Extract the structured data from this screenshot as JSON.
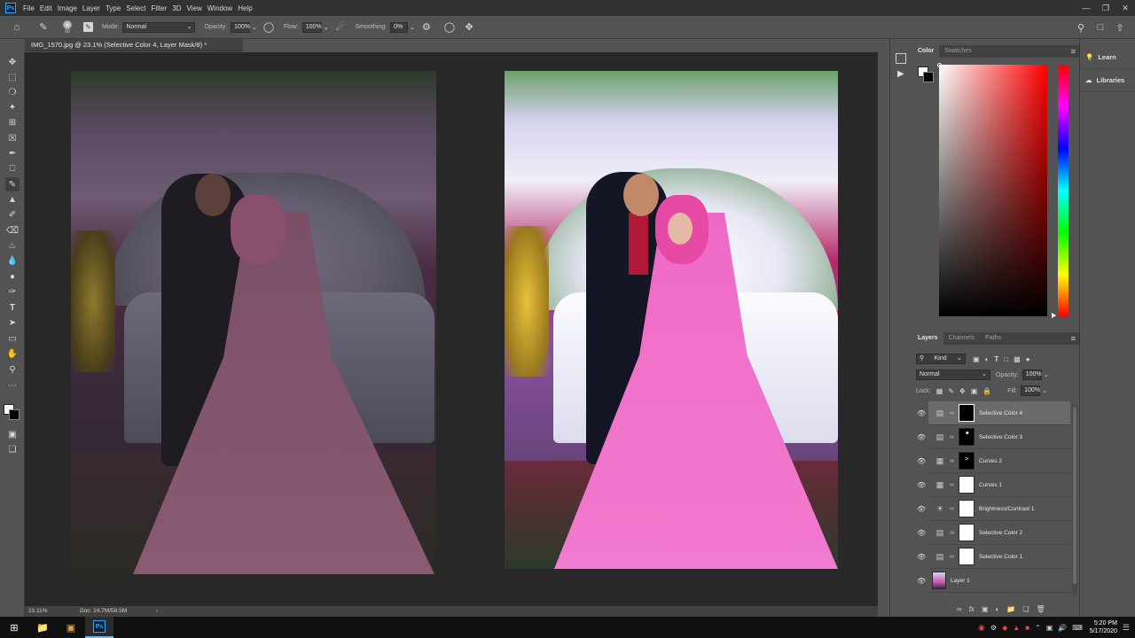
{
  "menubar": {
    "logo": "Ps",
    "items": [
      "File",
      "Edit",
      "Image",
      "Layer",
      "Type",
      "Select",
      "Filter",
      "3D",
      "View",
      "Window",
      "Help"
    ]
  },
  "options": {
    "mode_label": "Mode:",
    "mode_value": "Normal",
    "opacity_label": "Opacity:",
    "opacity_value": "100%",
    "flow_label": "Flow:",
    "flow_value": "100%",
    "smoothing_label": "Smoothing:",
    "smoothing_value": "0%",
    "brush_size": "60"
  },
  "document": {
    "tab_title": "IMG_1570.jpg @ 23.1% (Selective Color 4, Layer Mask/8) *",
    "zoom": "23.11%",
    "doc_info": "Doc: 24.7M/59.5M"
  },
  "color_panel": {
    "tabs": [
      "Color",
      "Swatches"
    ]
  },
  "right_strip": {
    "learn": "Learn",
    "libraries": "Libraries"
  },
  "layers_panel": {
    "tabs": [
      "Layers",
      "Channels",
      "Paths"
    ],
    "filter_kind": "Kind",
    "blend_mode": "Normal",
    "opacity_label": "Opacity:",
    "opacity_value": "100%",
    "lock_label": "Lock:",
    "fill_label": "Fill:",
    "fill_value": "100%",
    "layers": [
      {
        "name": "Selective Color 4",
        "icon": "selective-color",
        "mask": "black",
        "selected": true
      },
      {
        "name": "Selective Color 3",
        "icon": "selective-color",
        "mask": "black-dot",
        "selected": false
      },
      {
        "name": "Curves 2",
        "icon": "curves",
        "mask": "black-marks",
        "selected": false
      },
      {
        "name": "Curves 1",
        "icon": "curves",
        "mask": "white",
        "selected": false
      },
      {
        "name": "Brightness/Contrast 1",
        "icon": "brightness",
        "mask": "white",
        "selected": false
      },
      {
        "name": "Selective Color 2",
        "icon": "selective-color",
        "mask": "white",
        "selected": false
      },
      {
        "name": "Selective Color 1",
        "icon": "selective-color",
        "mask": "white",
        "selected": false
      },
      {
        "name": "Layer 1",
        "icon": "photo",
        "mask": "none",
        "selected": false
      }
    ]
  },
  "taskbar": {
    "time": "5:20 PM",
    "date": "5/17/2020"
  }
}
